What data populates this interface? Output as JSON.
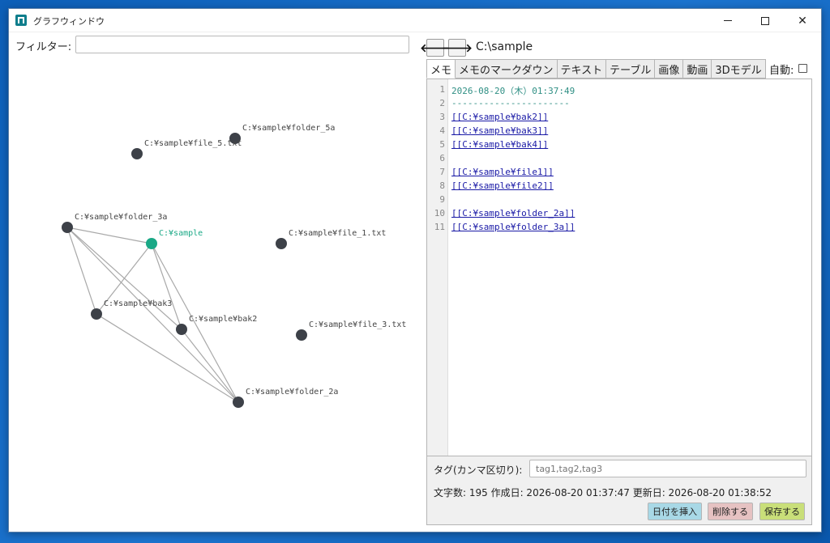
{
  "window": {
    "title": "グラフウィンドウ"
  },
  "left": {
    "filter_label": "フィルター:",
    "filter_value": ""
  },
  "graph": {
    "nodes": [
      {
        "id": "sample",
        "label": "C:¥sample",
        "highlight": true
      },
      {
        "id": "folder_5a",
        "label": "C:¥sample¥folder_5a"
      },
      {
        "id": "file_5",
        "label": "C:¥sample¥file_5.txt"
      },
      {
        "id": "folder_3a",
        "label": "C:¥sample¥folder_3a"
      },
      {
        "id": "file_1",
        "label": "C:¥sample¥file_1.txt"
      },
      {
        "id": "bak3",
        "label": "C:¥sample¥bak3"
      },
      {
        "id": "bak2",
        "label": "C:¥sample¥bak2"
      },
      {
        "id": "file_3",
        "label": "C:¥sample¥file_3.txt"
      },
      {
        "id": "folder_2a",
        "label": "C:¥sample¥folder_2a"
      }
    ],
    "edges": [
      [
        "folder_3a",
        "sample"
      ],
      [
        "folder_3a",
        "bak3"
      ],
      [
        "folder_3a",
        "bak2"
      ],
      [
        "folder_3a",
        "folder_2a"
      ],
      [
        "sample",
        "bak3"
      ],
      [
        "sample",
        "bak2"
      ],
      [
        "sample",
        "folder_2a"
      ],
      [
        "bak3",
        "folder_2a"
      ],
      [
        "bak2",
        "folder_2a"
      ]
    ],
    "colors": {
      "node": "#3d4148",
      "highlight": "#1aa886",
      "edge": "#a9a9a9"
    }
  },
  "right": {
    "back_icon": "arrow-left-icon",
    "forward_icon": "arrow-right-icon",
    "path": "C:\\sample",
    "tabs": [
      "メモ",
      "メモのマークダウン",
      "テキスト",
      "テーブル",
      "画像",
      "動画",
      "3Dモデル"
    ],
    "active_tab": 0,
    "auto_label": "自動:",
    "auto_checked": false,
    "editor": {
      "lines": [
        {
          "no": "1",
          "text": "2026-08-20（木）01:37:49",
          "kind": "date"
        },
        {
          "no": "2",
          "text": "----------------------",
          "kind": "rule"
        },
        {
          "no": "3",
          "text": "[[C:¥sample¥bak2]]",
          "kind": "link"
        },
        {
          "no": "4",
          "text": "[[C:¥sample¥bak3]]",
          "kind": "link"
        },
        {
          "no": "5",
          "text": "[[C:¥sample¥bak4]]",
          "kind": "link"
        },
        {
          "no": "6",
          "text": "",
          "kind": "plain"
        },
        {
          "no": "7",
          "text": "[[C:¥sample¥file1]]",
          "kind": "link"
        },
        {
          "no": "8",
          "text": "[[C:¥sample¥file2]]",
          "kind": "link"
        },
        {
          "no": "9",
          "text": "",
          "kind": "plain"
        },
        {
          "no": "10",
          "text": "[[C:¥sample¥folder_2a]]",
          "kind": "link"
        },
        {
          "no": "11",
          "text": "[[C:¥sample¥folder_3a]]",
          "kind": "link"
        }
      ]
    },
    "tags_label": "タグ(カンマ区切り):",
    "tags_placeholder": "tag1,tag2,tag3",
    "stats": "文字数: 195  作成日: 2026-08-20 01:37:47  更新日: 2026-08-20 01:38:52",
    "buttons": {
      "insert_date": "日付を挿入",
      "delete": "削除する",
      "save": "保存する"
    }
  }
}
